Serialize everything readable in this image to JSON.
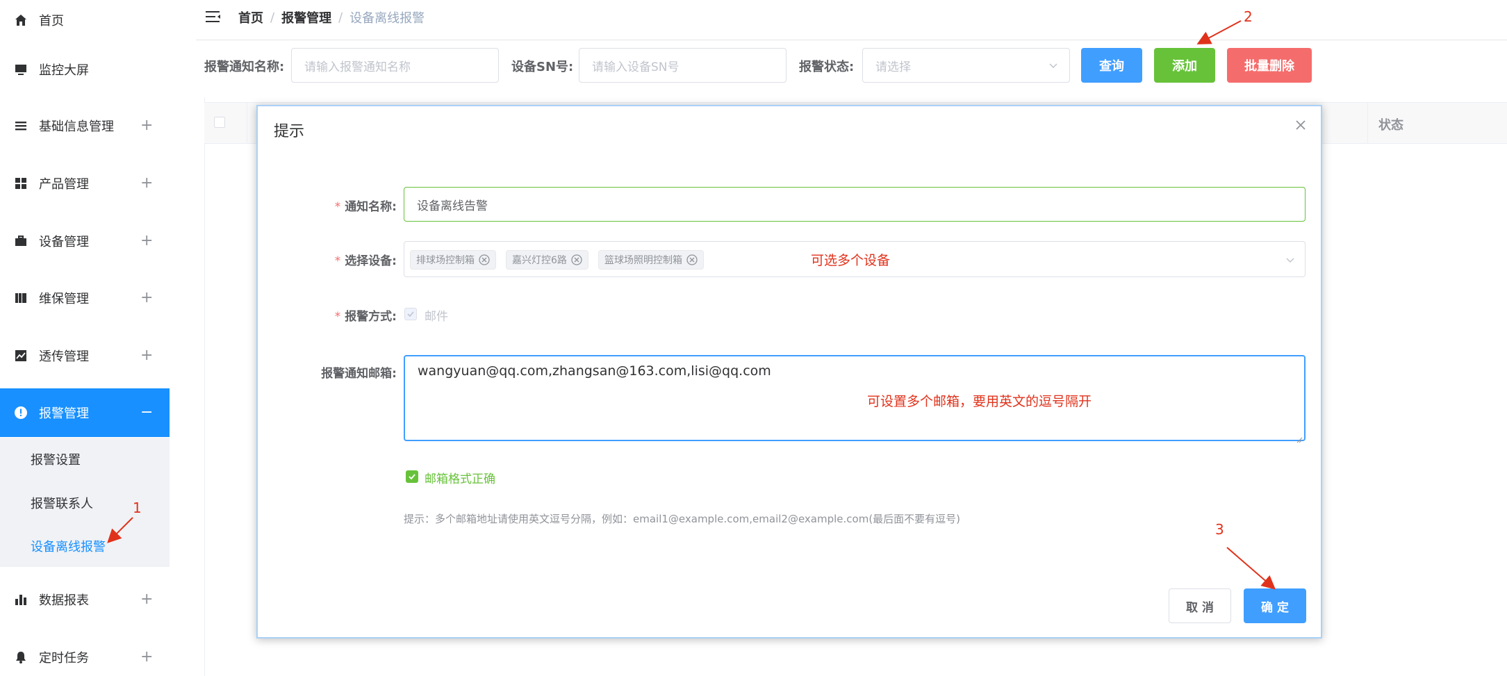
{
  "sidebar": {
    "items": [
      {
        "label": "首页",
        "icon": "home-icon"
      },
      {
        "label": "监控大屏",
        "icon": "monitor-icon"
      },
      {
        "label": "基础信息管理",
        "icon": "list-icon",
        "expand": "+"
      },
      {
        "label": "产品管理",
        "icon": "grid-icon",
        "expand": "+"
      },
      {
        "label": "设备管理",
        "icon": "briefcase-icon",
        "expand": "+"
      },
      {
        "label": "维保管理",
        "icon": "book-icon",
        "expand": "+"
      },
      {
        "label": "透传管理",
        "icon": "chart-line-icon",
        "expand": "+"
      },
      {
        "label": "报警管理",
        "icon": "alert-icon",
        "expand": "−"
      },
      {
        "label": "数据报表",
        "icon": "bar-chart-icon",
        "expand": "+"
      },
      {
        "label": "定时任务",
        "icon": "bell-icon",
        "expand": "+"
      }
    ],
    "submenu": [
      "报警设置",
      "报警联系人",
      "设备离线报警"
    ],
    "accent": "#1890ff"
  },
  "header": {
    "breadcrumb": [
      "首页",
      "报警管理",
      "设备离线报警"
    ],
    "sep": "/"
  },
  "search": {
    "name_label": "报警通知名称:",
    "name_placeholder": "请输入报警通知名称",
    "sn_label": "设备SN号:",
    "sn_placeholder": "请输入设备SN号",
    "status_label": "报警状态:",
    "status_placeholder": "请选择",
    "query_btn": "查询",
    "add_btn": "添加",
    "delete_btn": "批量删除"
  },
  "table": {
    "status_header": "状态"
  },
  "dialog": {
    "title": "提示",
    "required_mark": "*",
    "name_label": "通知名称:",
    "name_value": "设备离线告警",
    "devices_label": "选择设备:",
    "devices": [
      "排球场控制箱",
      "嘉兴灯控6路",
      "篮球场照明控制箱"
    ],
    "method_label": "报警方式:",
    "method_option": "邮件",
    "email_label": "报警通知邮箱:",
    "email_value": "wangyuan@qq.com,zhangsan@163.com,lisi@qq.com",
    "email_valid": "邮箱格式正确",
    "hint": "提示：多个邮箱地址请使用英文逗号分隔，例如：email1@example.com,email2@example.com(最后面不要有逗号)",
    "cancel_btn": "取 消",
    "confirm_btn": "确 定"
  },
  "annotations": {
    "devices_note": "可选多个设备",
    "email_note": "可设置多个邮箱，要用英文的逗号隔开",
    "step1": "1",
    "step2": "2",
    "step3": "3",
    "color": "#e0321b"
  }
}
